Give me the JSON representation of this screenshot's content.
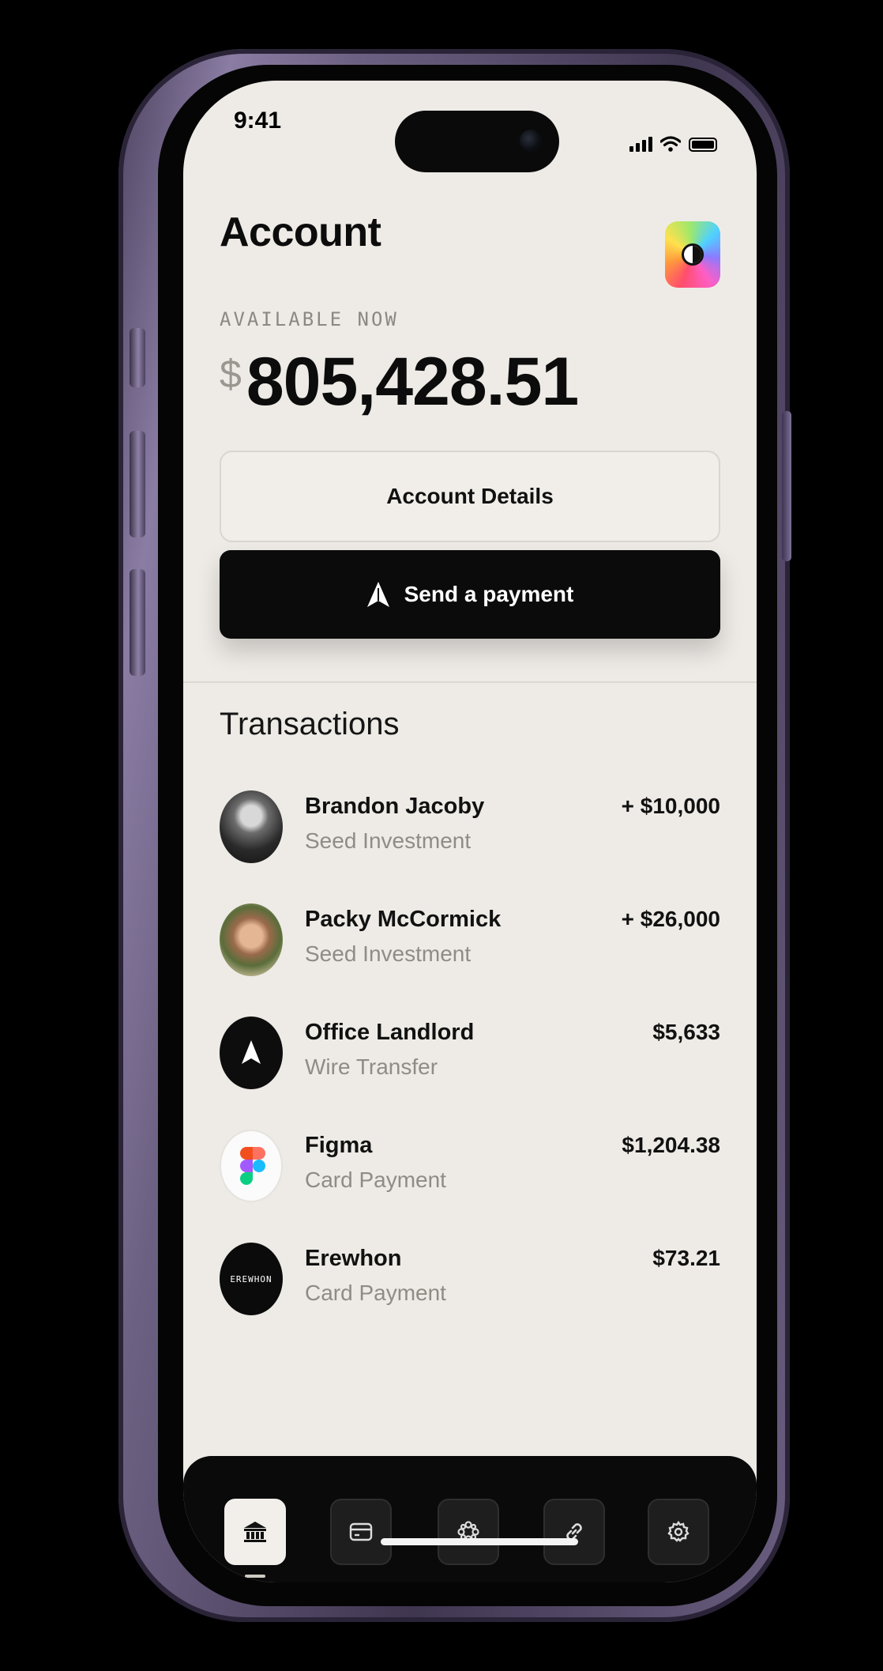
{
  "status": {
    "time": "9:41"
  },
  "header": {
    "title": "Account",
    "logo_icon": "app-logo-icon"
  },
  "balance": {
    "label": "AVAILABLE NOW",
    "currency": "$",
    "amount": "805,428.51"
  },
  "actions": {
    "details_label": "Account Details",
    "send_label": "Send a payment"
  },
  "transactions": {
    "title": "Transactions",
    "items": [
      {
        "name": "Brandon Jacoby",
        "sub": "Seed Investment",
        "amount": "+ $10,000"
      },
      {
        "name": "Packy McCormick",
        "sub": "Seed Investment",
        "amount": "+ $26,000"
      },
      {
        "name": "Office Landlord",
        "sub": "Wire Transfer",
        "amount": "$5,633"
      },
      {
        "name": "Figma",
        "sub": "Card Payment",
        "amount": "$1,204.38"
      },
      {
        "name": "Erewhon",
        "sub": "Card Payment",
        "amount": "$73.21",
        "logo_text": "EREWHON"
      }
    ]
  },
  "nav": {
    "items": [
      {
        "icon": "bank-icon",
        "active": true
      },
      {
        "icon": "card-icon",
        "active": false
      },
      {
        "icon": "apps-icon",
        "active": false
      },
      {
        "icon": "link-icon",
        "active": false
      },
      {
        "icon": "gear-icon",
        "active": false
      }
    ]
  },
  "colors": {
    "screen_bg": "#eeebe6",
    "primary": "#0b0b0b",
    "muted": "#8f8c86",
    "frame": "#6d6183"
  }
}
